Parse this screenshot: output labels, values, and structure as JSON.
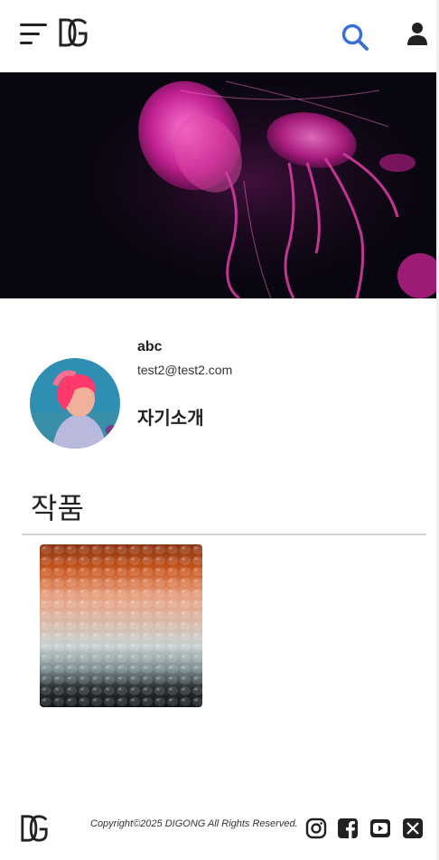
{
  "header": {
    "logo_text": "DG",
    "menu_icon": "hamburger-menu-icon",
    "search_icon": "search-icon",
    "user_icon": "user-icon",
    "accent_color": "#3a6fd8"
  },
  "banner": {
    "image": "pink jellyfish on dark background"
  },
  "profile": {
    "name": "abc",
    "email": "test2@test2.com",
    "bio_label": "자기소개",
    "avatar": "person with pink hair"
  },
  "works": {
    "title": "작품",
    "items": [
      {
        "image": "textured glass in orange and grey tones"
      }
    ]
  },
  "footer": {
    "logo_text": "DG",
    "copyright": "Copyright©2025 DIGONG All Rights Reserved.",
    "social_icons": [
      "instagram-icon",
      "facebook-icon",
      "youtube-icon",
      "x-icon"
    ]
  }
}
